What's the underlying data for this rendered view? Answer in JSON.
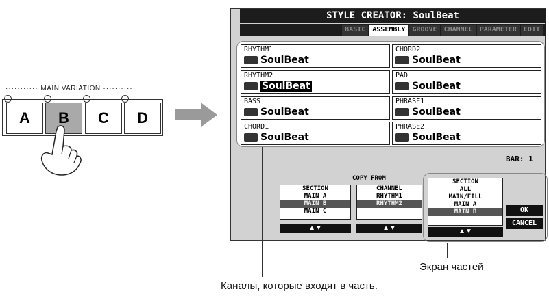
{
  "main_variation": {
    "title": "MAIN VARIATION",
    "buttons": [
      "A",
      "B",
      "C",
      "D"
    ],
    "active": "B"
  },
  "lcd": {
    "title": "STYLE CREATOR: SoulBeat",
    "tabs": [
      "BASIC",
      "ASSEMBLY",
      "GROOVE",
      "CHANNEL",
      "PARAMETER",
      "EDIT"
    ],
    "active_tab": "ASSEMBLY",
    "parts": [
      {
        "label": "RHYTHM1",
        "value": "SoulBeat",
        "icon": "drum-icon"
      },
      {
        "label": "CHORD2",
        "value": "SoulBeat",
        "icon": "guitar-icon"
      },
      {
        "label": "RHYTHM2",
        "value": "SoulBeat",
        "icon": "drum-icon",
        "selected": true
      },
      {
        "label": "PAD",
        "value": "SoulBeat",
        "icon": "organ-icon"
      },
      {
        "label": "BASS",
        "value": "SoulBeat",
        "icon": "bass-icon"
      },
      {
        "label": "PHRASE1",
        "value": "SoulBeat",
        "icon": "brass-icon"
      },
      {
        "label": "CHORD1",
        "value": "SoulBeat",
        "icon": "keyboard-icon"
      },
      {
        "label": "PHRASE2",
        "value": "SoulBeat",
        "icon": "guitar-icon"
      }
    ],
    "bar_label": "BAR:",
    "bar_value": "1",
    "copy_from": "COPY FROM",
    "copy_section": {
      "header": "SECTION",
      "items": [
        "MAIN A",
        "MAIN B",
        "MAIN C"
      ],
      "selected": "MAIN B"
    },
    "copy_channel": {
      "header": "CHANNEL",
      "items": [
        "RHYTHM1",
        "RHYTHM2"
      ],
      "selected": "RHYTHM2"
    },
    "section_box": {
      "header": "SECTION",
      "items": [
        "ALL",
        "MAIN/FILL",
        "MAIN A",
        "MAIN B"
      ],
      "selected": "MAIN B"
    },
    "arrows": "▲▼",
    "ok_label": "OK",
    "cancel_label": "CANCEL"
  },
  "annotations": {
    "parts_screen": "Экран частей",
    "channels": "Каналы, которые входят в часть."
  }
}
